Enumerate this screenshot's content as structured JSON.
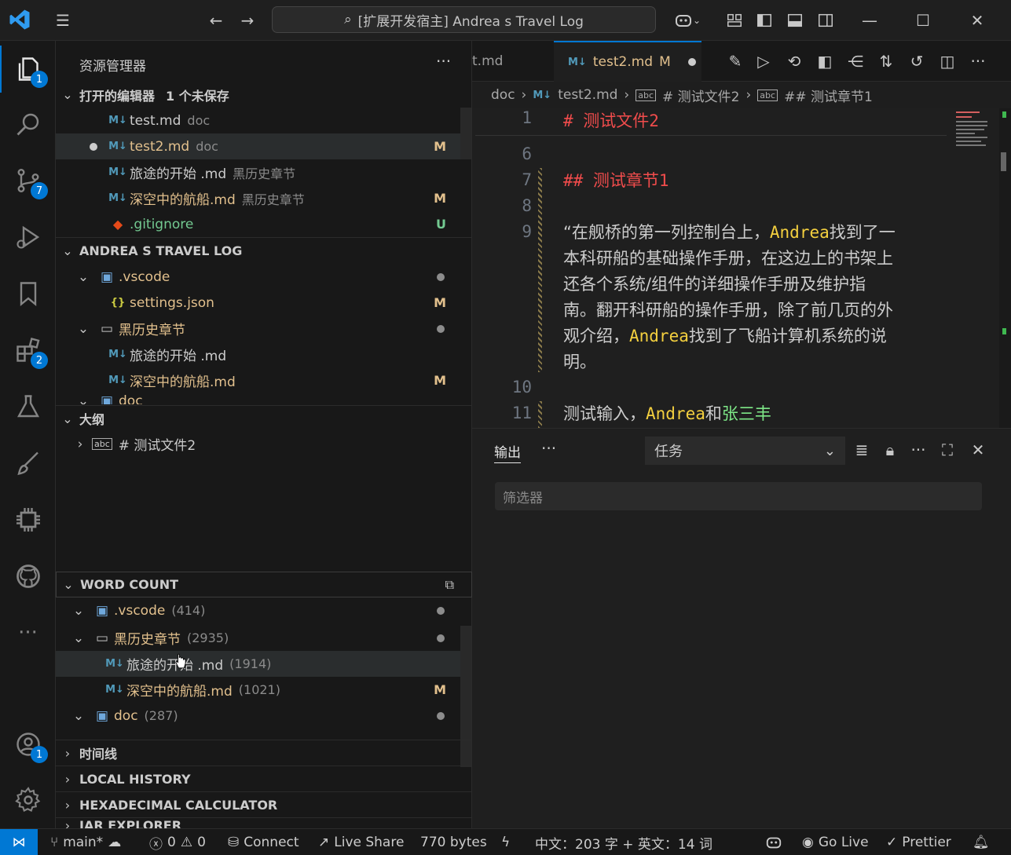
{
  "titlebar": {
    "search_text": "[扩展开发宿主] Andrea s Travel Log"
  },
  "activity": {
    "explorer_badge": "1",
    "scm_badge": "7",
    "extensions_badge": "2",
    "accounts_badge": "1"
  },
  "sidebar": {
    "title": "资源管理器",
    "open_editors": {
      "title": "打开的编辑器",
      "unsaved": "1 个未保存",
      "items": [
        {
          "name": "test.md",
          "desc": "doc",
          "status": ""
        },
        {
          "name": "test2.md",
          "desc": "doc",
          "status": "M"
        },
        {
          "name": "旅途的开始 .md",
          "desc": "黑历史章节",
          "status": ""
        },
        {
          "name": "深空中的航船.md",
          "desc": "黑历史章节",
          "status": "M"
        },
        {
          "name": ".gitignore",
          "desc": "",
          "status": "U"
        }
      ]
    },
    "workspace": {
      "title": "ANDREA S TRAVEL LOG",
      "items": [
        {
          "name": ".vscode",
          "status": ""
        },
        {
          "name": "settings.json",
          "status": "M"
        },
        {
          "name": "黑历史章节",
          "status": ""
        },
        {
          "name": "旅途的开始 .md",
          "status": ""
        },
        {
          "name": "深空中的航船.md",
          "status": "M"
        },
        {
          "name": "doc",
          "status": ""
        }
      ]
    },
    "outline": {
      "title": "大纲",
      "items": [
        {
          "name": "# 测试文件2"
        }
      ]
    },
    "word_count": {
      "title": "WORD COUNT",
      "items": [
        {
          "name": ".vscode",
          "count": "(414)",
          "status": ""
        },
        {
          "name": "黑历史章节",
          "count": "(2935)",
          "status": ""
        },
        {
          "name": "旅途的开始 .md",
          "count": "(1914)",
          "status": ""
        },
        {
          "name": "深空中的航船.md",
          "count": "(1021)",
          "status": "M"
        },
        {
          "name": "doc",
          "count": "(287)",
          "status": ""
        }
      ]
    },
    "timeline": {
      "title": "时间线"
    },
    "local_history": {
      "title": "LOCAL HISTORY"
    },
    "hex_calc": {
      "title": "HEXADECIMAL CALCULATOR"
    },
    "jar_explorer": {
      "title": "JAR EXPLORER"
    }
  },
  "editor": {
    "tabs": [
      {
        "label": "t.md"
      },
      {
        "label": "test2.md",
        "status": "M"
      }
    ],
    "breadcrumb": [
      "doc",
      "test2.md",
      "# 测试文件2",
      "## 测试章节1"
    ],
    "lines": [
      {
        "num": "1",
        "text": "# 测试文件2"
      },
      {
        "num": "6",
        "text": ""
      },
      {
        "num": "7",
        "text": "## 测试章节1"
      },
      {
        "num": "8",
        "text": ""
      },
      {
        "num": "9",
        "p1": "“在舰桥的第一列控制台上，",
        "k1": "Andrea",
        "p2": "找到了一",
        "l2": "本科研船的基础操作手册，在这边上的书架上",
        "l3": "还各个系统/组件的详细操作手册及维护指",
        "l4": "南。翻开科研船的操作手册，除了前几页的外",
        "l5a": "观介绍，",
        "k2": "Andrea",
        "l5b": "找到了飞船计算机系统的说",
        "l6": "明。"
      },
      {
        "num": "10",
        "text": ""
      },
      {
        "num": "11",
        "p1": "测试输入，",
        "k1": "Andrea",
        "p2": "和",
        "k2": "张三丰"
      }
    ]
  },
  "panel": {
    "tab_output": "输出",
    "task_select": "任务",
    "filter_placeholder": "筛选器"
  },
  "statusbar": {
    "branch": "main*",
    "errors": "0",
    "warnings": "0",
    "connect": "Connect",
    "live_share": "Live Share",
    "bytes": "770 bytes",
    "word_count": "中文：203 字 + 英文：14 词",
    "go_live": "Go Live",
    "prettier": "Prettier"
  },
  "colors": {
    "accent": "#0078d4",
    "modified": "#e2c08d",
    "untracked": "#73c991",
    "heading": "#f14c4c"
  }
}
